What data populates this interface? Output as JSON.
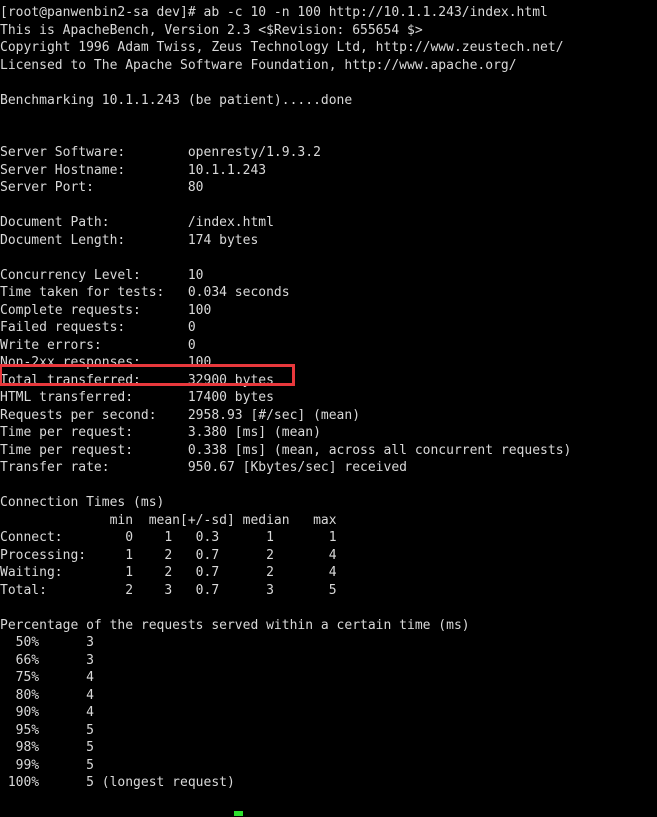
{
  "terminal": {
    "title": "ApacheBench terminal session",
    "background_color": "#000000",
    "foreground_color": "#d9d9d9",
    "cursor_color": "#2ee02e",
    "annotation_color": "#e8383c",
    "prompt": "[root@panwenbin2-sa dev]#",
    "command": "ab -c 10 -n 100 http://10.1.1.243/index.html",
    "lines": [
      "[root@panwenbin2-sa dev]# ab -c 10 -n 100 http://10.1.1.243/index.html",
      "This is ApacheBench, Version 2.3 <$Revision: 655654 $>",
      "Copyright 1996 Adam Twiss, Zeus Technology Ltd, http://www.zeustech.net/",
      "Licensed to The Apache Software Foundation, http://www.apache.org/",
      "",
      "Benchmarking 10.1.1.243 (be patient).....done",
      "",
      "",
      "Server Software:        openresty/1.9.3.2",
      "Server Hostname:        10.1.1.243",
      "Server Port:            80",
      "",
      "Document Path:          /index.html",
      "Document Length:        174 bytes",
      "",
      "Concurrency Level:      10",
      "Time taken for tests:   0.034 seconds",
      "Complete requests:      100",
      "Failed requests:        0",
      "Write errors:           0",
      "Non-2xx responses:      100",
      "Total transferred:      32900 bytes",
      "HTML transferred:       17400 bytes",
      "Requests per second:    2958.93 [#/sec] (mean)",
      "Time per request:       3.380 [ms] (mean)",
      "Time per request:       0.338 [ms] (mean, across all concurrent requests)",
      "Transfer rate:          950.67 [Kbytes/sec] received",
      "",
      "Connection Times (ms)",
      "              min  mean[+/-sd] median   max",
      "Connect:        0    1   0.3      1       1",
      "Processing:     1    2   0.7      2       4",
      "Waiting:        1    2   0.7      2       4",
      "Total:          2    3   0.7      3       5",
      "",
      "Percentage of the requests served within a certain time (ms)",
      "  50%      3",
      "  66%      3",
      "  75%      4",
      "  80%      4",
      "  90%      4",
      "  95%      5",
      "  98%      5",
      "  99%      5",
      " 100%      5 (longest request)"
    ]
  },
  "benchmark": {
    "tool": "ApacheBench",
    "version": "2.3",
    "revision": "655654",
    "copyright": "Copyright 1996 Adam Twiss, Zeus Technology Ltd, http://www.zeustech.net/",
    "license": "Licensed to The Apache Software Foundation, http://www.apache.org/",
    "benchmarking_host": "10.1.1.243",
    "benchmarking_status": "(be patient).....done",
    "server_software": "openresty/1.9.3.2",
    "server_hostname": "10.1.1.243",
    "server_port": "80",
    "document_path": "/index.html",
    "document_length": "174 bytes",
    "concurrency_level": "10",
    "time_taken_for_tests": "0.034 seconds",
    "complete_requests": "100",
    "failed_requests": "0",
    "write_errors": "0",
    "non_2xx_responses": "100",
    "total_transferred": "32900 bytes",
    "html_transferred": "17400 bytes",
    "requests_per_second": "2958.93 [#/sec] (mean)",
    "time_per_request_mean": "3.380 [ms] (mean)",
    "time_per_request_concurrent": "0.338 [ms] (mean, across all concurrent requests)",
    "transfer_rate": "950.67 [Kbytes/sec] received",
    "connection_times_title": "Connection Times (ms)",
    "connection_times_headers": [
      "min",
      "mean[+/-sd]",
      "median",
      "max"
    ],
    "connection_times_rows": [
      {
        "label": "Connect:",
        "min": "0",
        "mean": "1",
        "sd": "0.3",
        "median": "1",
        "max": "1"
      },
      {
        "label": "Processing:",
        "min": "1",
        "mean": "2",
        "sd": "0.7",
        "median": "2",
        "max": "4"
      },
      {
        "label": "Waiting:",
        "min": "1",
        "mean": "2",
        "sd": "0.7",
        "median": "2",
        "max": "4"
      },
      {
        "label": "Total:",
        "min": "2",
        "mean": "3",
        "sd": "0.7",
        "median": "3",
        "max": "5"
      }
    ],
    "percentile_title": "Percentage of the requests served within a certain time (ms)",
    "percentiles": [
      {
        "pct": "50%",
        "ms": "3",
        "note": ""
      },
      {
        "pct": "66%",
        "ms": "3",
        "note": ""
      },
      {
        "pct": "75%",
        "ms": "4",
        "note": ""
      },
      {
        "pct": "80%",
        "ms": "4",
        "note": ""
      },
      {
        "pct": "90%",
        "ms": "4",
        "note": ""
      },
      {
        "pct": "95%",
        "ms": "5",
        "note": ""
      },
      {
        "pct": "98%",
        "ms": "5",
        "note": ""
      },
      {
        "pct": "99%",
        "ms": "5",
        "note": ""
      },
      {
        "pct": "100%",
        "ms": "5",
        "note": "(longest request)"
      }
    ]
  }
}
